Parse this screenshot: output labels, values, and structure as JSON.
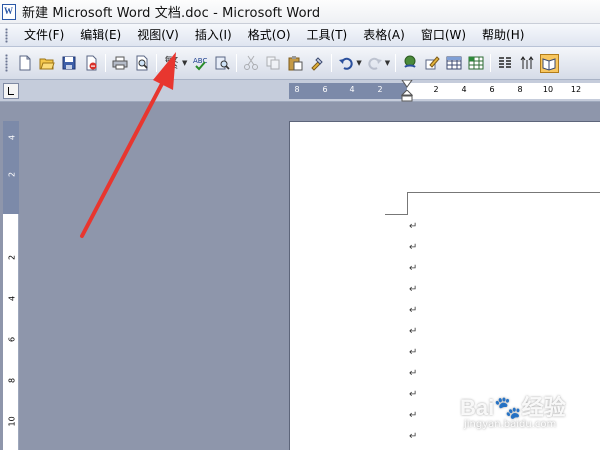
{
  "window": {
    "title": "新建 Microsoft Word 文档.doc - Microsoft Word",
    "app_icon": "word-doc-icon"
  },
  "menubar": {
    "items": [
      {
        "label": "文件(F)"
      },
      {
        "label": "编辑(E)"
      },
      {
        "label": "视图(V)"
      },
      {
        "label": "插入(I)"
      },
      {
        "label": "格式(O)"
      },
      {
        "label": "工具(T)"
      },
      {
        "label": "表格(A)"
      },
      {
        "label": "窗口(W)"
      },
      {
        "label": "帮助(H)"
      }
    ]
  },
  "toolbar": {
    "trad_simplified_label": "繁",
    "buttons": [
      "new-document-icon",
      "open-folder-icon",
      "save-icon",
      "permission-icon",
      "print-icon",
      "print-preview-icon",
      "traditional-simplified-icon",
      "spelling-icon",
      "research-icon",
      "cut-icon",
      "copy-icon",
      "paste-icon",
      "format-painter-icon",
      "undo-icon",
      "redo-icon",
      "hyperlink-icon",
      "drawing-icon",
      "insert-table-icon",
      "excel-worksheet-icon",
      "columns-icon",
      "show-hide-icon",
      "read-mode-icon"
    ]
  },
  "ruler": {
    "horizontal_ticks_margin": [
      "8",
      "6",
      "4",
      "2"
    ],
    "horizontal_ticks_text": [
      "2",
      "4",
      "6",
      "8",
      "10",
      "12"
    ],
    "vertical_ticks_margin": [
      "4",
      "2"
    ],
    "vertical_ticks_text": [
      "2",
      "4",
      "6",
      "8",
      "10"
    ]
  },
  "document": {
    "paragraph_mark": "↵",
    "paragraph_count": 11
  },
  "watermark": {
    "logo": "Bai🐾经验",
    "site": "jingyan.baidu.com"
  },
  "colors": {
    "workspace": "#8e96ab",
    "annotation_arrow": "#e8362f",
    "active_button": "#f7c65f"
  }
}
